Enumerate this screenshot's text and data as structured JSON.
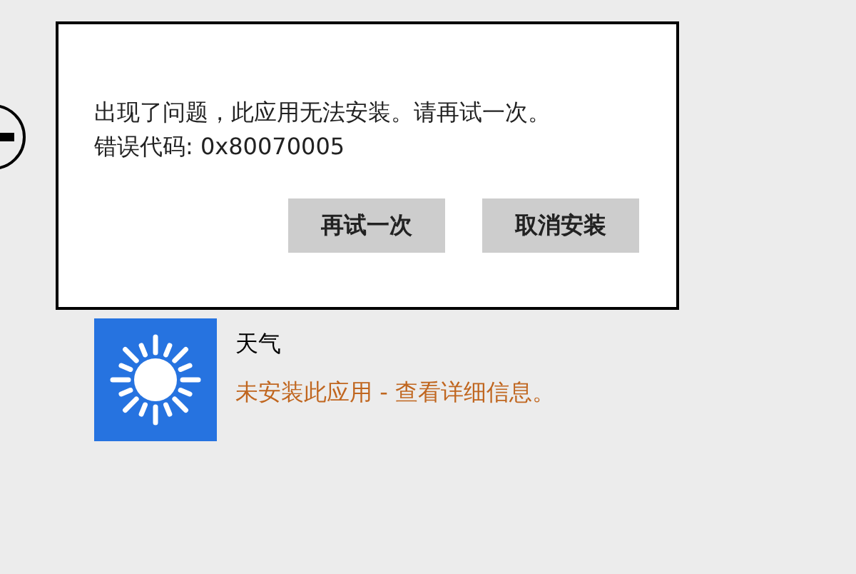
{
  "dialog": {
    "message_lines": [
      "出现了问题，此应用无法安装。请再试一次。",
      "错误代码: 0x80070005"
    ],
    "buttons": [
      "再试一次",
      "取消安装"
    ]
  },
  "app": {
    "name": "天气",
    "status_link": "未安装此应用 - 查看详细信息。"
  }
}
